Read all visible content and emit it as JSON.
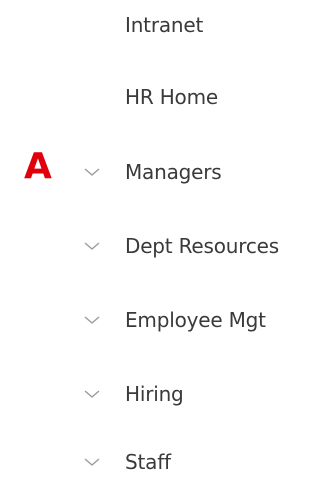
{
  "nav": {
    "items": [
      {
        "label": "Intranet",
        "has_chevron": false
      },
      {
        "label": "HR Home",
        "has_chevron": false
      },
      {
        "label": "Managers",
        "has_chevron": true
      },
      {
        "label": "Dept Resources",
        "has_chevron": true
      },
      {
        "label": "Employee Mgt",
        "has_chevron": true
      },
      {
        "label": "Hiring",
        "has_chevron": true
      },
      {
        "label": "Staff",
        "has_chevron": true
      }
    ]
  },
  "annotation": {
    "text": "A",
    "color": "#e0000b"
  },
  "colors": {
    "text": "#3a3a3a",
    "chevron": "#9a9a9a",
    "background": "#ffffff"
  }
}
